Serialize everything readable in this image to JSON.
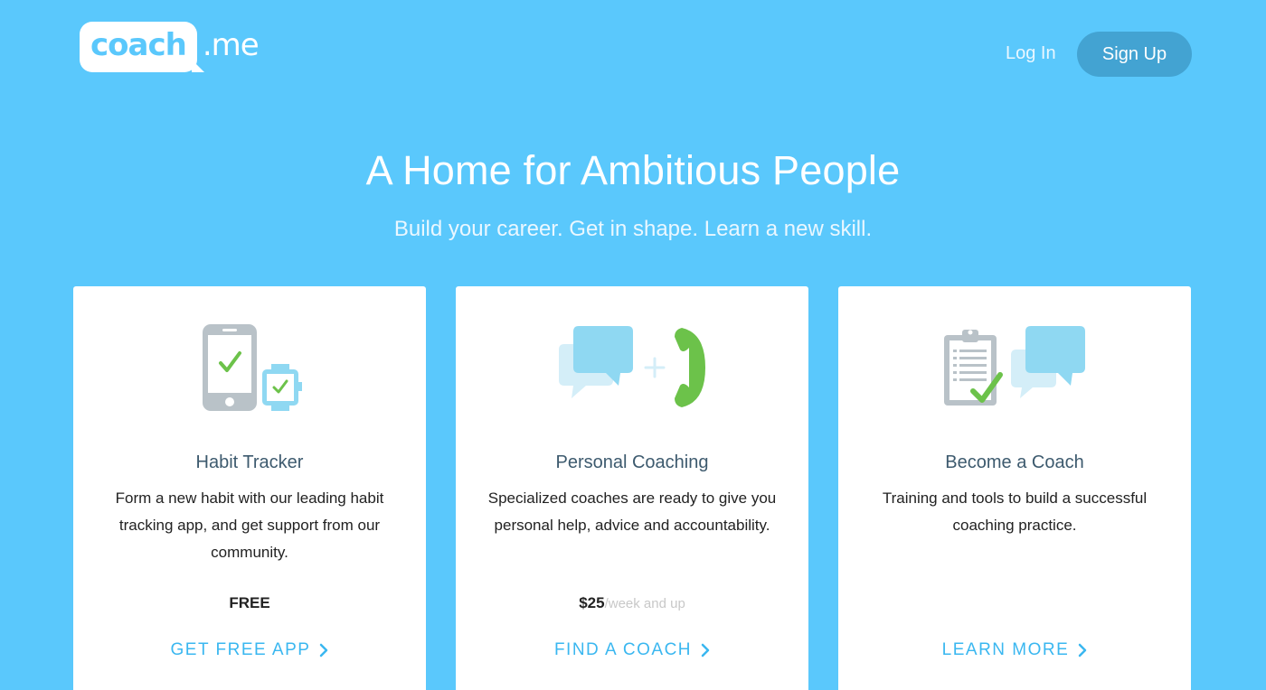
{
  "header": {
    "logo": {
      "bubble_text": "coach",
      "rest_text": ".me"
    },
    "login_label": "Log In",
    "signup_label": "Sign Up"
  },
  "hero": {
    "title": "A Home for Ambitious People",
    "subtitle": "Build your career. Get in shape. Learn a new skill."
  },
  "cards": [
    {
      "icon": "phone-and-watch-check-icon",
      "title": "Habit Tracker",
      "description": "Form a new habit with our leading habit tracking app, and get support from our community.",
      "price": "FREE",
      "price_unit": "",
      "cta": "GET FREE APP"
    },
    {
      "icon": "chat-plus-phone-icon",
      "title": "Personal Coaching",
      "description": "Specialized coaches are ready to give you personal help, advice and accountability.",
      "price": "$25",
      "price_unit": "/week and up",
      "cta": "FIND A COACH"
    },
    {
      "icon": "clipboard-check-chat-icon",
      "title": "Become a Coach",
      "description": "Training and tools to build a successful coaching practice.",
      "price": "",
      "price_unit": "",
      "cta": "LEARN MORE"
    }
  ],
  "colors": {
    "background": "#5ac8fc",
    "accent": "#3ab7f0",
    "signup_button": "#43a3d2",
    "icon_green": "#6cc24a",
    "icon_gray": "#b9c2c8",
    "icon_light_blue": "#8fd8f2"
  }
}
